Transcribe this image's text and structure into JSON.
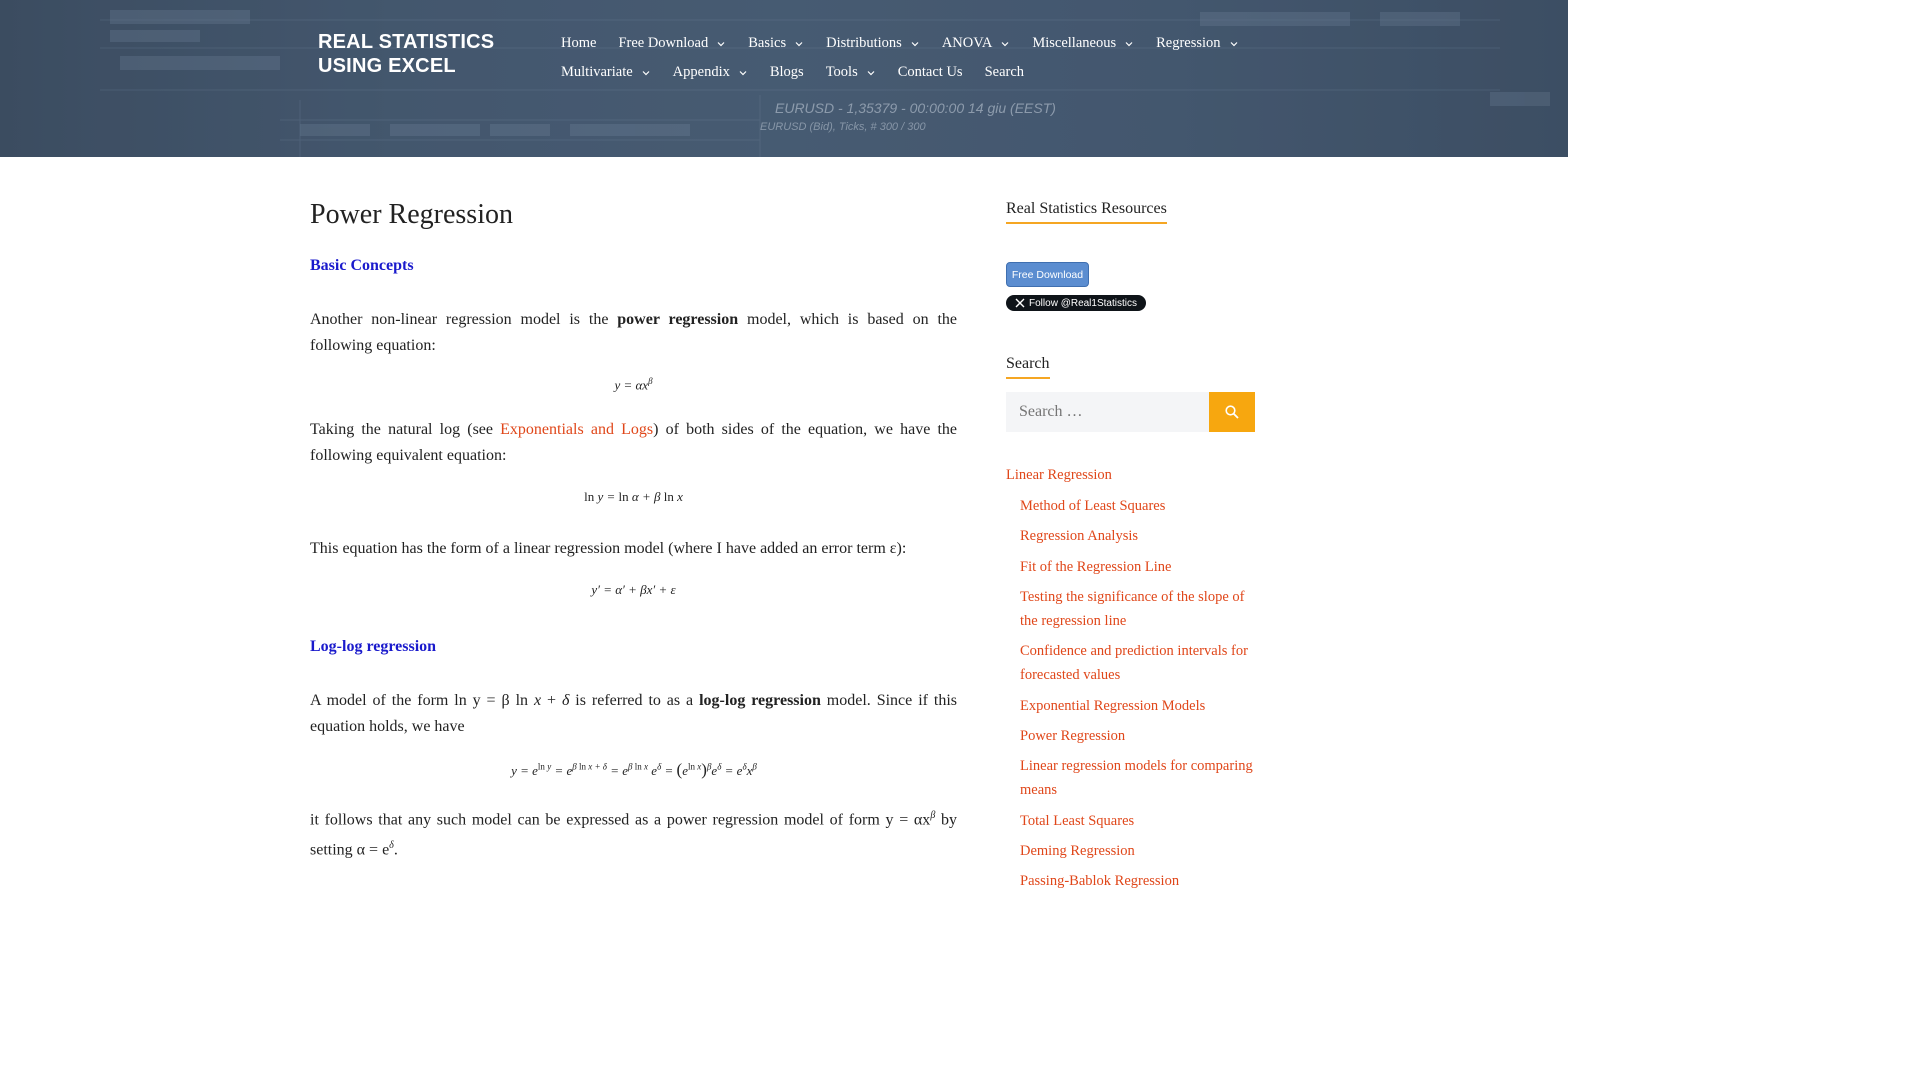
{
  "header": {
    "site_title_line1": "REAL STATISTICS",
    "site_title_line2": "USING EXCEL",
    "chart_overlay_text": "EURUSD - 1,35379 - 00:00:00  14 giu (EEST)",
    "chart_overlay_sub": "EURUSD (Bid), Ticks, # 300 / 300",
    "nav_row1": [
      {
        "label": "Home",
        "dropdown": false
      },
      {
        "label": "Free Download",
        "dropdown": true
      },
      {
        "label": "Basics",
        "dropdown": true
      },
      {
        "label": "Distributions",
        "dropdown": true
      },
      {
        "label": "ANOVA",
        "dropdown": true
      },
      {
        "label": "Miscellaneous",
        "dropdown": true
      },
      {
        "label": "Regression",
        "dropdown": true
      }
    ],
    "nav_row2": [
      {
        "label": "Multivariate",
        "dropdown": true
      },
      {
        "label": "Appendix",
        "dropdown": true
      },
      {
        "label": "Blogs",
        "dropdown": false
      },
      {
        "label": "Tools",
        "dropdown": true
      },
      {
        "label": "Contact Us",
        "dropdown": false
      },
      {
        "label": "Search",
        "dropdown": false
      }
    ]
  },
  "article": {
    "title": "Power Regression",
    "section1": "Basic Concepts",
    "p1_a": "Another non-linear regression model is the ",
    "p1_b": "power regression",
    "p1_c": " model, which is based on the following equation:",
    "p2_a": "Taking the natural log (see ",
    "p2_link": "Exponentials and Logs",
    "p2_b": ") of both sides of the equation, we have the following equivalent equation:",
    "p3": "This equation has the form of a linear regression model (where I have added an error term ε):",
    "section2": "Log-log regression",
    "p4_a": "A model of the form ln y = β ln ",
    "p4_x": "x",
    "p4_b": " + ",
    "p4_d": "δ",
    "p4_c": " is referred to as a ",
    "p4_bold": "log-log regression",
    "p4_e": " model. Since if this equation holds, we have",
    "p5_a": "it follows that any such model can be expressed as a power regression model of form y = αx",
    "p5_sup": "β",
    "p5_b": " by setting α = e",
    "p5_sup2": "δ",
    "p5_c": "."
  },
  "sidebar": {
    "resources_title": "Real Statistics Resources",
    "free_download_btn": "Free Download",
    "follow_btn": "Follow @Real1Statistics",
    "search_title": "Search",
    "search_placeholder": "Search …",
    "links": {
      "top": "Linear Regression",
      "items": [
        "Method of Least Squares",
        "Regression Analysis",
        "Fit of the Regression Line",
        "Testing the significance of the slope of the regression line",
        "Confidence and prediction intervals for forecasted values",
        "Exponential Regression Models",
        "Power Regression",
        "Linear regression models for comparing means",
        "Total Least Squares",
        "Deming Regression",
        "Passing-Bablok Regression"
      ]
    }
  },
  "colors": {
    "header_bg": "#465a71",
    "link": "#e0471a",
    "section_heading": "#1a1acc",
    "accent": "#f5a623",
    "search_button": "#f7a70f",
    "free_download_btn": "#5b8dd0"
  }
}
